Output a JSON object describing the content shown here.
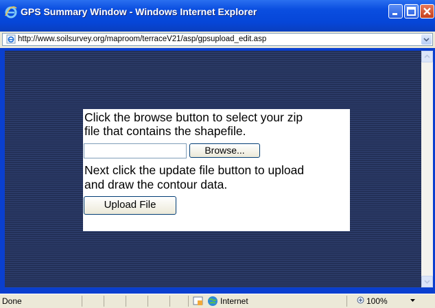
{
  "window": {
    "title": "GPS Summary Window - Windows Internet Explorer"
  },
  "addressbar": {
    "url": "http://www.soilsurvey.org/maproom/terraceV21/asp/gpsupload_edit.asp"
  },
  "panel": {
    "instruction1_line1": "Click the browse button to select your zip",
    "instruction1_line2": "file that contains the shapefile.",
    "file_input_value": "",
    "browse_label": "Browse...",
    "instruction2_line1": "Next click the update file button to upload",
    "instruction2_line2": "and draw the contour data.",
    "upload_label": "Upload File"
  },
  "statusbar": {
    "status": "Done",
    "zone": "Internet",
    "zoom": "100%"
  },
  "colors": {
    "titlebar": "#0a4ee0",
    "page_background": "#233057",
    "panel": "#ffffff"
  }
}
